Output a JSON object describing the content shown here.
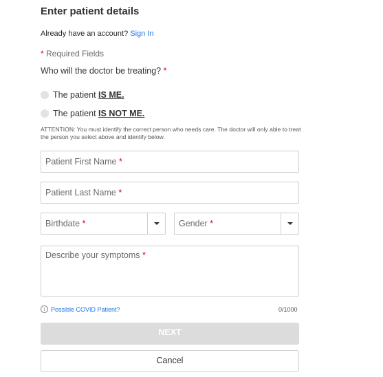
{
  "header": {
    "title": "Enter patient details"
  },
  "account": {
    "prompt": "Already have an account?",
    "sign_in": "Sign In"
  },
  "required": {
    "asterisk": "*",
    "label": "Required Fields"
  },
  "question": {
    "text": "Who will the doctor be treating?"
  },
  "options": [
    {
      "prefix": "The patient",
      "emph": "IS ME."
    },
    {
      "prefix": "The patient",
      "emph": "IS NOT ME."
    }
  ],
  "attention": "ATTENTION: You must identify the correct person who needs care. The doctor will only able to treat the person you select above and identify below.",
  "fields": {
    "first_name": "Patient First Name",
    "last_name": "Patient Last Name",
    "birthdate": "Birthdate",
    "gender": "Gender",
    "symptoms": "Describe your symptoms"
  },
  "covid": {
    "info_glyph": "i",
    "label": "Possible COVID Patient?"
  },
  "counter": "0/1000",
  "buttons": {
    "next": "NEXT",
    "cancel": "Cancel"
  },
  "colors": {
    "link": "#1a73e8",
    "required": "#d0021b",
    "disabled_button": "#dcdcdc"
  }
}
